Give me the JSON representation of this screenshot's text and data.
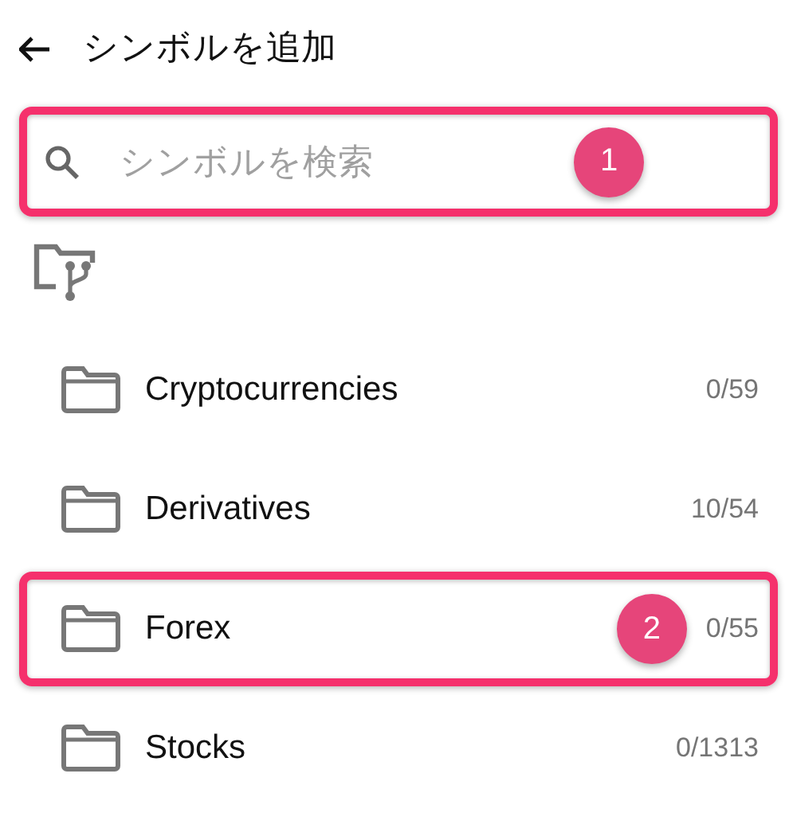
{
  "header": {
    "title": "シンボルを追加"
  },
  "search": {
    "placeholder": "シンボルを検索",
    "highlighted": true,
    "badge": "1"
  },
  "folders": [
    {
      "name": "Cryptocurrencies",
      "count": "0/59",
      "highlighted": false
    },
    {
      "name": "Derivatives",
      "count": "10/54",
      "highlighted": false
    },
    {
      "name": "Forex",
      "count": "0/55",
      "highlighted": true,
      "badge": "2"
    },
    {
      "name": "Stocks",
      "count": "0/1313",
      "highlighted": false
    }
  ]
}
